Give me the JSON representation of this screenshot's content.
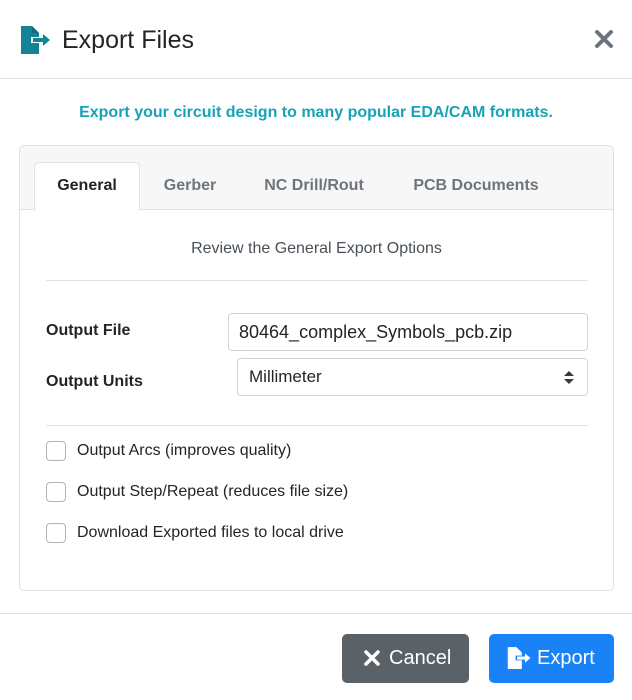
{
  "dialog": {
    "title": "Export Files",
    "header_icon": "file-export-icon",
    "close_icon": "close-icon"
  },
  "subtitle": "Export your circuit design to many popular EDA/CAM formats.",
  "tabs": [
    {
      "label": "General",
      "active": true
    },
    {
      "label": "Gerber",
      "active": false
    },
    {
      "label": "NC Drill/Rout",
      "active": false
    },
    {
      "label": "PCB Documents",
      "active": false
    }
  ],
  "general": {
    "heading": "Review the General Export Options",
    "output_file_label": "Output File",
    "output_file_value": "80464_complex_Symbols_pcb.zip",
    "output_units_label": "Output Units",
    "output_units_value": "Millimeter",
    "options": [
      {
        "label": "Output Arcs (improves quality)",
        "checked": false
      },
      {
        "label": "Output Step/Repeat (reduces file size)",
        "checked": false
      },
      {
        "label": "Download Exported files to local drive",
        "checked": false
      }
    ]
  },
  "footer": {
    "cancel_label": "Cancel",
    "cancel_icon": "close-icon",
    "export_label": "Export",
    "export_icon": "file-export-icon"
  },
  "colors": {
    "accent_teal": "#17a2b8",
    "primary_blue": "#1a82f7",
    "secondary_gray": "#5a6268",
    "icon_teal": "#138496"
  }
}
